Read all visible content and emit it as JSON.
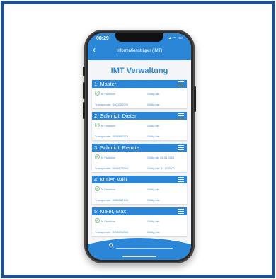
{
  "status": {
    "time": "08:29",
    "icons": "▴ ≈ ▭"
  },
  "nav": {
    "back_icon": "chevron-left-icon",
    "title": "Informationsträger (IMT)"
  },
  "page": {
    "heading": "IMT Verwaltung"
  },
  "cards": [
    {
      "title": "1: Master",
      "function_label": "In Funktion",
      "valid_from": "Gültig ab:",
      "transponder": "Transponder: 0000000000",
      "valid_to": "Gültig bis:"
    },
    {
      "title": "2: Schmidt, Dieter",
      "function_label": "In Funktion",
      "valid_from": "Gültig ab:",
      "transponder": "Transponder: 0098890376",
      "valid_to": "Gültig bis:"
    },
    {
      "title": "3: Schmidt, Renate",
      "function_label": "In Funktion",
      "valid_from": "Gültig ab: 01.01.2020",
      "transponder": "Transponder: 0098872554",
      "valid_to": "Gültig bis: 31.12.2021"
    },
    {
      "title": "4: Müller, Willi",
      "function_label": "In Funktion",
      "valid_from": "Gültig ab:",
      "transponder": "Transponder: 0086867100",
      "valid_to": "Gültig bis:"
    },
    {
      "title": "5: Meier, Max",
      "function_label": "In Funktion",
      "valid_from": "Gültig ab:",
      "transponder": "Transponder: 3708096363",
      "valid_to": "Gültig bis:"
    }
  ],
  "icons": {
    "menu": "hamburger-menu-icon",
    "check": "check-circle-icon",
    "search": "search-icon"
  },
  "colors": {
    "frame": "#1f4f8c",
    "accent": "#2c86d8",
    "check": "#3a9b4e"
  }
}
